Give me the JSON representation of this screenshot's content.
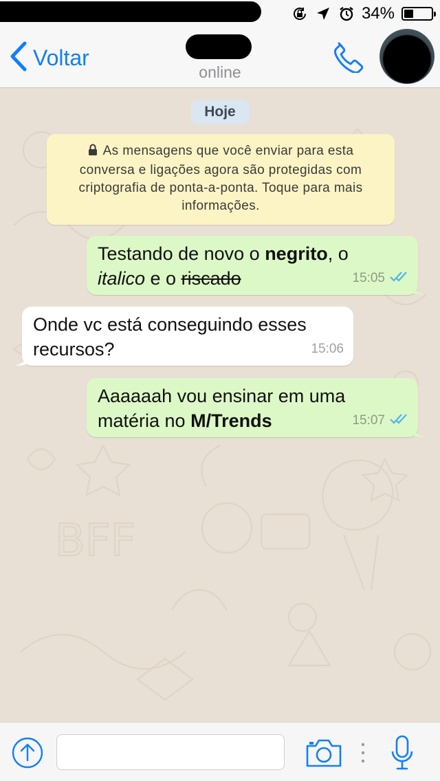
{
  "status_bar": {
    "battery_percent": "34%",
    "battery_level": 0.34,
    "icons": [
      "orientation-lock-icon",
      "location-arrow-icon",
      "alarm-clock-icon",
      "battery-icon"
    ]
  },
  "header": {
    "back_label": "Voltar",
    "contact_status": "online",
    "icons": [
      "chevron-left-icon",
      "phone-icon"
    ]
  },
  "chat": {
    "date_label": "Hoje",
    "encryption_notice": "As mensagens que você enviar para esta conversa e ligações agora são protegidas com criptografia de ponta-a-ponta. Toque para mais informações.",
    "messages": [
      {
        "direction": "outgoing",
        "parts": {
          "p1": "Testando de novo o ",
          "bold": "negrito",
          "p2": ", o",
          "italic": "italico",
          "p3": " e o ",
          "strike": "riscado"
        },
        "time": "15:05",
        "read": true
      },
      {
        "direction": "incoming",
        "parts": {
          "line1": "Onde vc está conseguindo esses",
          "line2": "recursos?"
        },
        "time": "15:06"
      },
      {
        "direction": "outgoing",
        "parts": {
          "line1": "Aaaaaah vou ensinar em uma",
          "p2": "matéria no ",
          "bold": "M/Trends"
        },
        "time": "15:07",
        "read": true
      }
    ]
  },
  "input_bar": {
    "message_value": "",
    "icons": [
      "arrow-up-circle-icon",
      "camera-icon",
      "more-dots-icon",
      "microphone-icon"
    ]
  },
  "colors": {
    "accent": "#127efb",
    "outgoing_bubble": "#dcf8c6",
    "incoming_bubble": "#ffffff",
    "notice_bg": "#fcf4c4",
    "date_pill_bg": "#dbe6f2",
    "read_ticks": "#4fb5ec"
  }
}
